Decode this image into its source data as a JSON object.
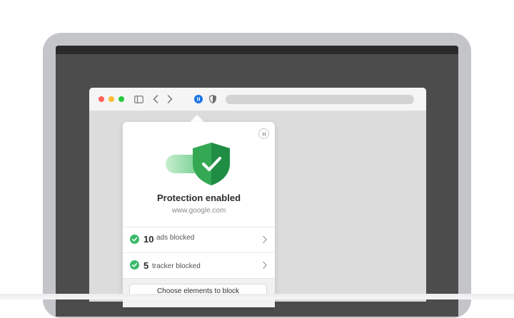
{
  "colors": {
    "accent_green": "#3cb96a",
    "shield_green": "#34a853",
    "pause_blue": "#1a73e8",
    "laptop_frame": "#c4c5c9"
  },
  "browser": {
    "toolbar_icons": [
      "sidebar-icon",
      "back-icon",
      "forward-icon",
      "ext-pause-icon",
      "shield-ext-icon"
    ]
  },
  "popover": {
    "title": "Protection enabled",
    "site": "www.google.com",
    "stats": [
      {
        "count": "10",
        "label": "ads blocked"
      },
      {
        "count": "5",
        "label": "tracker blocked"
      }
    ],
    "button_label": "Choose elements to block"
  }
}
